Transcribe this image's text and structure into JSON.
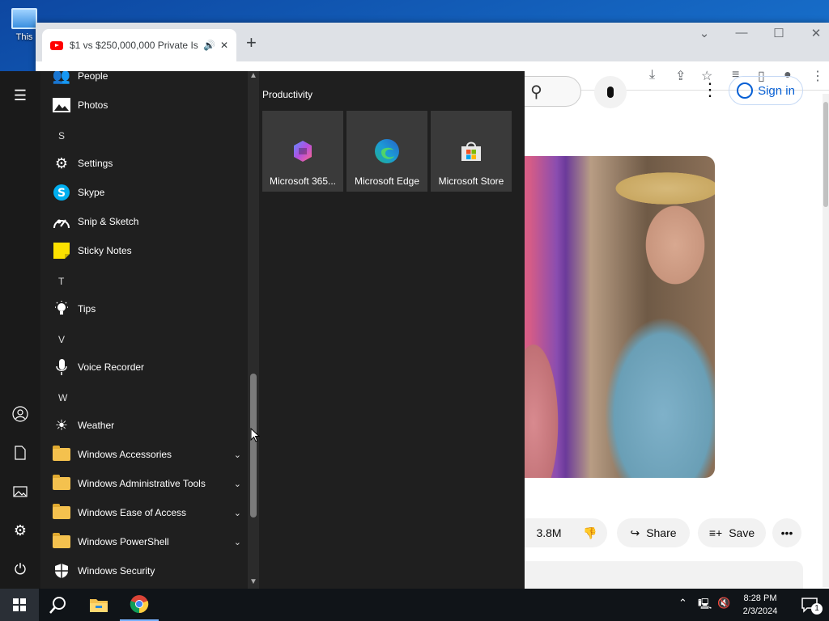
{
  "desktop": {
    "icon_label": "This"
  },
  "browser": {
    "tab_title": "$1 vs $250,000,000 Private Is",
    "newtab_glyph": "+",
    "youtube": {
      "signin_label": "Sign in"
    },
    "actions": {
      "likes": "3.8M",
      "share_label": "Share",
      "save_label": "Save"
    }
  },
  "start_menu": {
    "apps": [
      {
        "label": "People"
      },
      {
        "label": "Photos"
      },
      {
        "letter": "S"
      },
      {
        "label": "Settings"
      },
      {
        "label": "Skype"
      },
      {
        "label": "Snip & Sketch"
      },
      {
        "label": "Sticky Notes"
      },
      {
        "letter": "T"
      },
      {
        "label": "Tips"
      },
      {
        "letter": "V"
      },
      {
        "label": "Voice Recorder"
      },
      {
        "letter": "W"
      },
      {
        "label": "Weather"
      },
      {
        "label": "Windows Accessories"
      },
      {
        "label": "Windows Administrative Tools"
      },
      {
        "label": "Windows Ease of Access"
      },
      {
        "label": "Windows PowerShell"
      },
      {
        "label": "Windows Security"
      }
    ],
    "group_title": "Productivity",
    "tiles": [
      {
        "label": "Microsoft 365..."
      },
      {
        "label": "Microsoft Edge"
      },
      {
        "label": "Microsoft Store"
      }
    ]
  },
  "taskbar": {
    "time": "8:28 PM",
    "date": "2/3/2024",
    "notification_count": "1"
  }
}
